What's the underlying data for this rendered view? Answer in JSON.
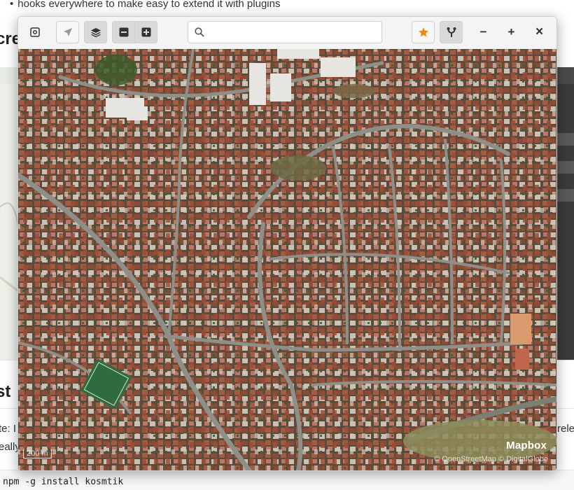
{
  "background_page": {
    "bullet_text": "hooks everywhere to make easy to extend it with plugins",
    "heading_1": "cre",
    "heading_2": "st",
    "note_fragment": "te: I",
    "note_fragment_2": "eally",
    "right_fragment": "rele",
    "code": "npm -g install kosmtik"
  },
  "toolbar": {
    "settings_icon": "settings-icon",
    "locate_icon": "locate-arrow-icon",
    "layers_icon": "layers-icon",
    "zoom_out_icon": "zoom-out-square-icon",
    "zoom_in_icon": "zoom-in-square-icon",
    "search_placeholder": "",
    "search_value": "",
    "favorite_icon": "star-icon",
    "favorite_color": "#f0870f",
    "branch_icon": "branch-icon"
  },
  "window_controls": {
    "minimize": "−",
    "maximize": "+",
    "close": "×"
  },
  "map": {
    "logo": "Mapbox",
    "attribution": "© OpenStreetMap © DigitalGlobe",
    "scale_label": "200 m"
  }
}
